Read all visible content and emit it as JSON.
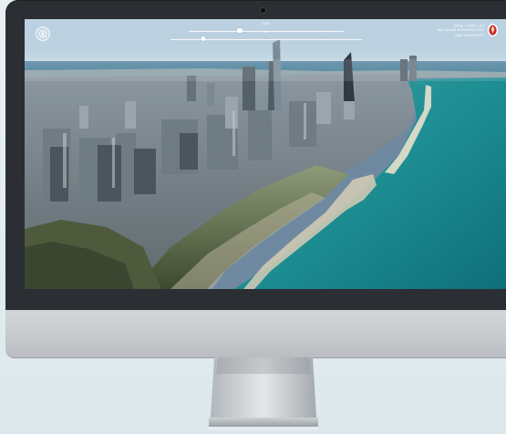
{
  "page": {
    "background": "#dfe9ee"
  },
  "monitor": {
    "bezel_color": "#2b2f33",
    "chin_color": "#c9cdd0"
  },
  "viewer": {
    "top_slider": {
      "label": "2030",
      "value": 0.33
    },
    "bottom_slider": {
      "label": "1:1",
      "value": 0.17
    },
    "compass_icon": "compass-icon",
    "logo": {
      "arabic_text": "دائرة البلديات والنقل",
      "english_line1": "ABU DHABI MUNICIPALITIES",
      "english_line2": "AND TRANSPORT",
      "emblem_icon": "falcon-emblem-icon"
    }
  }
}
